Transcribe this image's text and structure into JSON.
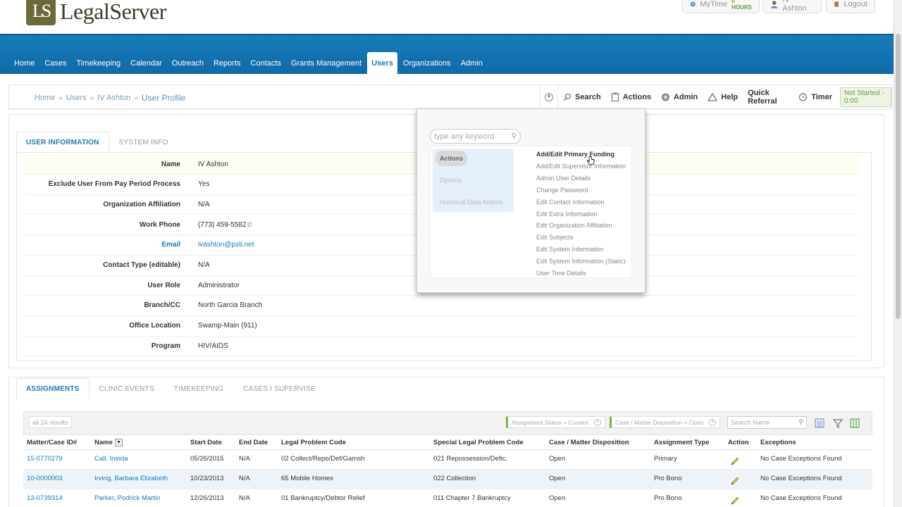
{
  "header": {
    "logo_mark": "LS",
    "logo_text": "LegalServer",
    "mytime_label": "MyTime",
    "mytime_hours": "0 HOURS",
    "user_name": "IV Ashton",
    "logout_label": "Logout"
  },
  "nav": {
    "items": [
      "Home",
      "Cases",
      "Timekeeping",
      "Calendar",
      "Outreach",
      "Reports",
      "Contacts",
      "Grants Management",
      "Users",
      "Organizations",
      "Admin"
    ],
    "active": "Users"
  },
  "breadcrumb": {
    "items": [
      "Home",
      "Users",
      "IV Ashton"
    ],
    "current": "User Profile"
  },
  "toolbar": {
    "search": "Search",
    "actions": "Actions",
    "admin": "Admin",
    "help": "Help",
    "quick_referral": "Quick Referral",
    "timer": "Timer",
    "timer_status": "Not Started - 0:00"
  },
  "info_tabs": [
    "USER INFORMATION",
    "SYSTEM INFO"
  ],
  "user_info": [
    {
      "label": "Name",
      "value": "IV Ashton"
    },
    {
      "label": "Exclude User From Pay Period Process",
      "value": "Yes"
    },
    {
      "label": "Organization Affiliation",
      "value": "N/A"
    },
    {
      "label": "Work Phone",
      "value": "(773) 459-5582"
    },
    {
      "label": "Email",
      "value": "ivashton@psti.net"
    },
    {
      "label": "Contact Type (editable)",
      "value": "N/A"
    },
    {
      "label": "User Role",
      "value": "Administrator"
    },
    {
      "label": "Branch/CC",
      "value": "North Garcia Branch"
    },
    {
      "label": "Office Location",
      "value": "Swamp-Main (911)"
    },
    {
      "label": "Program",
      "value": "HIV/AIDS"
    }
  ],
  "popup": {
    "search_placeholder": "type any keyword",
    "categories": [
      "Actions",
      "Options",
      "Historical Data Actions"
    ],
    "items": [
      "Add/Edit Primary Funding",
      "Add/Edit Supervisor Information",
      "Admin User Details",
      "Change Password",
      "Edit Contact Information",
      "Edit Extra Information",
      "Edit Organization Affiliation",
      "Edit Subjects",
      "Edit System Information",
      "Edit System Information (Static)",
      "User Time Details"
    ]
  },
  "assignment_tabs": [
    "ASSIGNMENTS",
    "CLINIC EVENTS",
    "TIMEKEEPING",
    "CASES I SUPERVISE"
  ],
  "assignments": {
    "results": "all 24 results",
    "filter1": "Assignment Status = Current",
    "filter2": "Case / Matter Disposition = Open",
    "search_placeholder": "Search Name",
    "columns": [
      "Matter/Case ID#",
      "Name",
      "Start Date",
      "End Date",
      "Legal Problem Code",
      "Special Legal Problem Code",
      "Case / Matter Disposition",
      "Assignment Type",
      "Action",
      "Exceptions"
    ],
    "rows": [
      [
        "15-0770279",
        "Call, Ineida",
        "05/26/2015",
        "N/A",
        "02 Collect/Repo/Def/Garnsh",
        "021 Repossession/Defic.",
        "Open",
        "Primary",
        "No Case Exceptions Found"
      ],
      [
        "10-0000003",
        "Irving, Barbara Elizabeth",
        "10/23/2013",
        "N/A",
        "65 Mobile Homes",
        "022 Collection",
        "Open",
        "Pro Bono",
        "No Case Exceptions Found"
      ],
      [
        "13-0739314",
        "Parker, Podrick Martin",
        "12/26/2013",
        "N/A",
        "01 Bankruptcy/Debtor Relief",
        "011 Chapter 7 Bankruptcy",
        "Open",
        "Pro Bono",
        "No Case Exceptions Found"
      ]
    ]
  }
}
